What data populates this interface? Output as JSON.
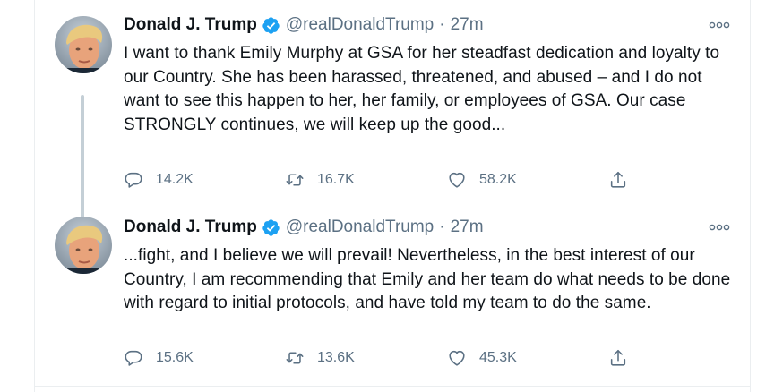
{
  "tweets": [
    {
      "name": "Donald J. Trump",
      "handle": "@realDonaldTrump",
      "separator": "·",
      "time": "27m",
      "text": "I want to thank Emily Murphy at GSA for her steadfast dedication and loyalty to our Country. She has been harassed, threatened, and abused – and I do not want to see this happen to her, her family, or employees of GSA. Our case STRONGLY continues, we will keep up the good...",
      "replies": "14.2K",
      "retweets": "16.7K",
      "likes": "58.2K"
    },
    {
      "name": "Donald J. Trump",
      "handle": "@realDonaldTrump",
      "separator": "·",
      "time": "27m",
      "text": "...fight, and I believe we will prevail! Nevertheless, in the best interest of our Country, I am recommending that Emily and her team do what needs to be done with regard to initial protocols, and have told my team to do the same.",
      "replies": "15.6K",
      "retweets": "13.6K",
      "likes": "45.3K"
    }
  ],
  "icons": {
    "verified": "verified-badge-icon",
    "more": "more-options-icon",
    "reply": "reply-icon",
    "retweet": "retweet-icon",
    "like": "like-icon",
    "share": "share-icon"
  },
  "colors": {
    "verified_blue": "#1da1f2",
    "secondary_text": "#5b7083",
    "thread_line": "#c4cfd6",
    "border": "#ebeef0"
  }
}
